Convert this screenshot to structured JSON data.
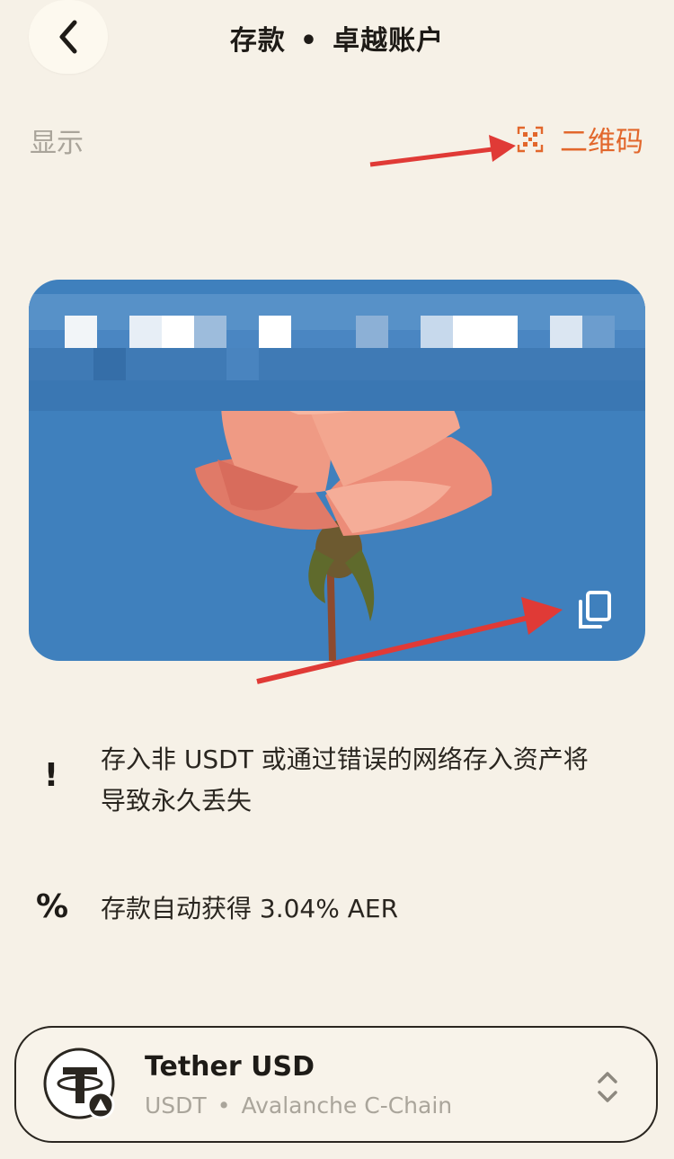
{
  "header": {
    "title_left": "存款",
    "title_sep": "•",
    "title_right": "卓越账户"
  },
  "toolbar": {
    "show_label": "显示",
    "qr_label": "二维码"
  },
  "notices": [
    {
      "icon": "exclamation-icon",
      "symbol": "!",
      "text": "存入非 USDT 或通过错误的网络存入资产将导致永久丢失"
    },
    {
      "icon": "percent-icon",
      "symbol": "%",
      "text": "存款自动获得 3.04% AER"
    }
  ],
  "asset": {
    "name": "Tether USD",
    "symbol": "USDT",
    "sep": "•",
    "network": "Avalanche C-Chain"
  },
  "colors": {
    "accent": "#e2672c",
    "background": "#f6f1e7",
    "card_blue": "#3f80bd",
    "annotation_arrow": "#e03a36"
  }
}
